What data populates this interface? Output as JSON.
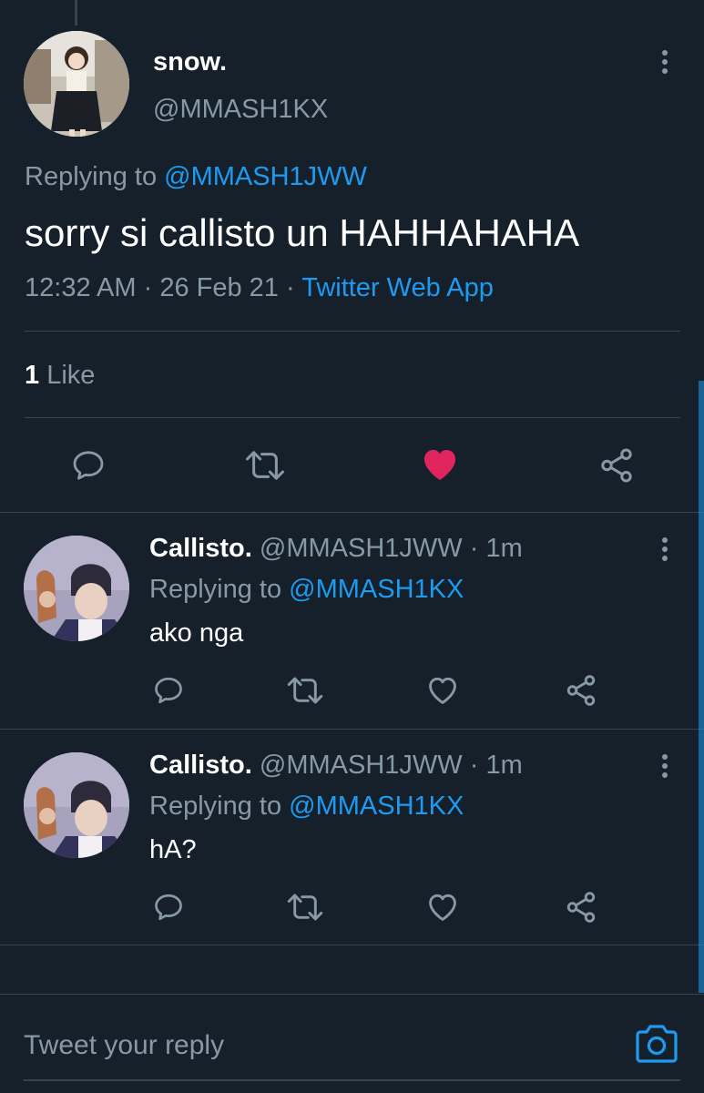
{
  "main_tweet": {
    "display_name": "snow.",
    "handle": "@MMASH1KX",
    "replying_prefix": "Replying to",
    "replying_to": "@MMASH1JWW",
    "text": "sorry si callisto un HAHHAHAHA",
    "time": "12:32 AM",
    "date": "26 Feb 21",
    "separator": "·",
    "source": "Twitter Web App",
    "like_count": "1",
    "like_label": "Like"
  },
  "replies": [
    {
      "display_name": "Callisto.",
      "handle": "@MMASH1JWW",
      "separator": "·",
      "age": "1m",
      "replying_prefix": "Replying to",
      "replying_to": "@MMASH1KX",
      "text": "ako nga"
    },
    {
      "display_name": "Callisto.",
      "handle": "@MMASH1JWW",
      "separator": "·",
      "age": "1m",
      "replying_prefix": "Replying to",
      "replying_to": "@MMASH1KX",
      "text": "hA?"
    }
  ],
  "composer": {
    "placeholder": "Tweet your reply"
  },
  "icons": {
    "reply": "speech-bubble-icon",
    "retweet": "retweet-icon",
    "like": "heart-icon",
    "share": "share-icon",
    "more": "more-vertical-icon",
    "camera": "camera-icon"
  },
  "colors": {
    "background": "#15202b",
    "accent": "#1d9bf0",
    "liked": "#e0245e",
    "secondary_text": "#8899a6",
    "divider": "#38444d"
  }
}
